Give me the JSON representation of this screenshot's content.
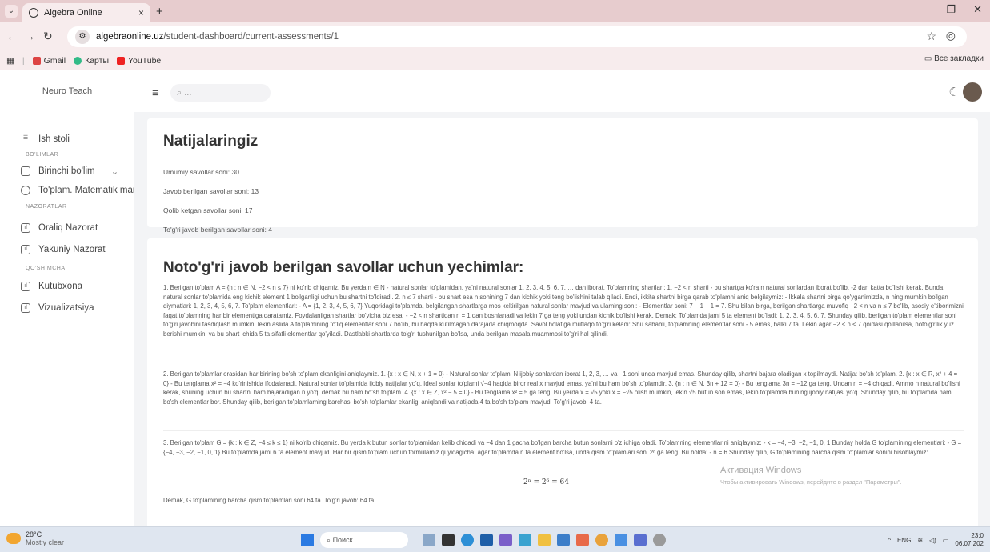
{
  "browser": {
    "tab_title": "Algebra Online",
    "tab_close": "×",
    "new_tab": "+",
    "url_host": "algebraonline.uz",
    "url_path": "/student-dashboard/current-assessments/1",
    "bookmarks": [
      "Gmail",
      "Карты",
      "YouTube"
    ],
    "bookmarks_right": "Все закладки"
  },
  "sidebar": {
    "logo": "Neuro Teach",
    "items": [
      {
        "label": "Ish stoli"
      },
      {
        "section": "BO'LIMLAR"
      },
      {
        "label": "Birinchi bo'lim"
      },
      {
        "label": "To'plam. Matematik mantiq"
      },
      {
        "section": "NAZORATLAR"
      },
      {
        "label": "Oraliq Nazorat"
      },
      {
        "label": "Yakuniy Nazorat"
      },
      {
        "section": "QO'SHIMCHA"
      },
      {
        "label": "Kutubxona"
      },
      {
        "label": "Vizualizatsiya"
      }
    ]
  },
  "topbar": {
    "search_placeholder": "..."
  },
  "results": {
    "title": "Natijalaringiz",
    "stats": [
      "Umumiy savollar soni: 30",
      "Javob berilgan savollar soni: 13",
      "Qolib ketgan savollar soni: 17",
      "To'g'ri javob berilgan savollar soni: 4"
    ]
  },
  "solutions": {
    "title": "Noto'g'ri javob berilgan savollar uchun yechimlar:",
    "items": [
      "1. Berilgan to'plam A = {n : n ∈ N, −2 < n ≤ 7} ni ko'rib chiqamiz. Bu yerda n ∈ N - natural sonlar to'plamidan, ya'ni natural sonlar 1, 2, 3, 4, 5, 6, 7, … dan iborat. To'plamning shartlari: 1. −2 < n sharti - bu shartga ko'ra n natural sonlardan iborat bo'lib, -2 dan katta bo'lishi kerak. Bunda, natural sonlar to'plamida eng kichik element 1 bo'lganligi uchun bu shartni to'ldiradi. 2. n ≤ 7 sharti - bu shart esa n sonining 7 dan kichik yoki teng bo'lishini talab qiladi. Endi, ikkita shartni birga qarab to'plamni aniq belgilaymiz: - Ikkala shartni birga qo'yganimizda, n ning mumkin bo'lgan qiymatlari: 1, 2, 3, 4, 5, 6, 7. To'plam elementlari: - A = {1, 2, 3, 4, 5, 6, 7} Yuqoridagi to'plamda, belgilangan shartlarga mos keltirilgan natural sonlar mavjud va ularning soni: - Elementlar soni: 7 − 1 + 1 = 7. Shu bilan birga, berilgan shartlarga muvofiq −2 < n va n ≤ 7 bo'lib, asosiy e'tiborimizni faqat to'plamning har bir elementiga qaratamiz. Foydalanilgan shartlar bo'yicha biz esa: - −2 < n shartidan n = 1 dan boshlanadi va lekin 7 ga teng yoki undan kichik bo'lishi kerak. Demak: To'plamda jami 5 ta element bo'ladi: 1, 2, 3, 4, 5, 6, 7. Shunday qilib, berilgan to'plam elementlar soni to'g'ri javobini tasdiqlash mumkin, lekin aslida A to'plamining to'liq elementlar soni 7 bo'lib, bu haqda kutilmagan darajada chiqmoqda. Savol holatiga mutlaqo to'g'ri keladi: Shu sababli, to'plamning elementlar soni - 5 emas, balki 7 ta. Lekin agar −2 < n < 7 qoidasi qo'llanilsa, noto'g'rilik yuz berishi mumkin, va bu shart ichida 5 ta sifatli elementlar qo'yiladi. Dastlabki shartlarda to'g'ri tushunilgan bo'lsa, unda berilgan masala muammosi to'g'ri hal qilindi.",
      "2. Berilgan to'plamlar orasidan har birining bo'sh to'plam ekanligini aniqlaymiz. 1. {x : x ∈ N, x + 1 = 0} - Natural sonlar to'plami N ijobiy sonlardan iborat 1, 2, 3, … va −1 soni unda mavjud emas. Shunday qilib, shartni bajara oladigan x topilmaydi. Natija: bo'sh to'plam. 2. {x : x ∈ R, x² + 4 = 0} - Bu tenglama x² = −4 ko'rinishida ifodalanadi. Natural sonlar to'plamida ijobiy natijalar yo'q. Ideal sonlar to'plami √−4 haqida biror real x mavjud emas, ya'ni bu ham bo'sh to'plamdir. 3. {n : n ∈ N, 3n + 12 = 0} - Bu tenglama 3n = −12 ga teng. Undan n = −4 chiqadi. Ammo n natural bo'lishi kerak, shuning uchun bu shartni ham bajaradigan n yo'q, demak bu ham bo'sh to'plam. 4. {x : x ∈ Z, x² − 5 = 0} - Bu tenglama x² = 5 ga teng. Bu yerda x = √5 yoki x = −√5 olish mumkin, lekin √5 butun son emas, lekin to'plamda buning ijobiy natijasi yo'q. Shunday qilib, bu to'plamda ham bo'sh elementlar bor. Shunday qilib, berilgan to'plamlarning barchasi bo'sh to'plamlar ekanligi aniqlandi va natijada 4 ta bo'sh to'plam mavjud. To'g'ri javob: 4 ta.",
      "3. Berilgan to'plam G = {k : k ∈ Z, −4 ≤ k ≤ 1} ni ko'rib chiqamiz. Bu yerda k butun sonlar to'plamidan kelib chiqadi va −4 dan 1 gacha bo'lgan barcha butun sonlarni o'z ichiga oladi. To'plamning elementlarini aniqlaymiz: - k = −4, −3, −2, −1, 0, 1 Bunday holda G to'plamining elementlari: - G = {−4, −3, −2, −1, 0, 1} Bu to'plamda jami 6 ta element mavjud. Har bir qism to'plam uchun formulamiz quyidagicha: agar to'plamda n ta element bo'lsa, unda qism to'plamlari soni 2ⁿ ga teng. Bu holda: - n = 6 Shunday qilib, G to'plamining barcha qism to'plamlar sonini hisoblaymiz:"
    ],
    "formula": "2ⁿ = 2⁶ = 64",
    "conclusion": "Demak, G to'plamining barcha qism to'plamlari soni 64 ta. To'g'ri javob: 64 ta."
  },
  "watermark": {
    "line1": "Активация Windows",
    "line2": "Чтобы активировать Windows, перейдите в раздел \"Параметры\"."
  },
  "taskbar": {
    "temp": "28°C",
    "weather": "Mostly clear",
    "search": "Поиск",
    "lang": "ENG",
    "time": "23:0",
    "date": "06.07.202"
  }
}
